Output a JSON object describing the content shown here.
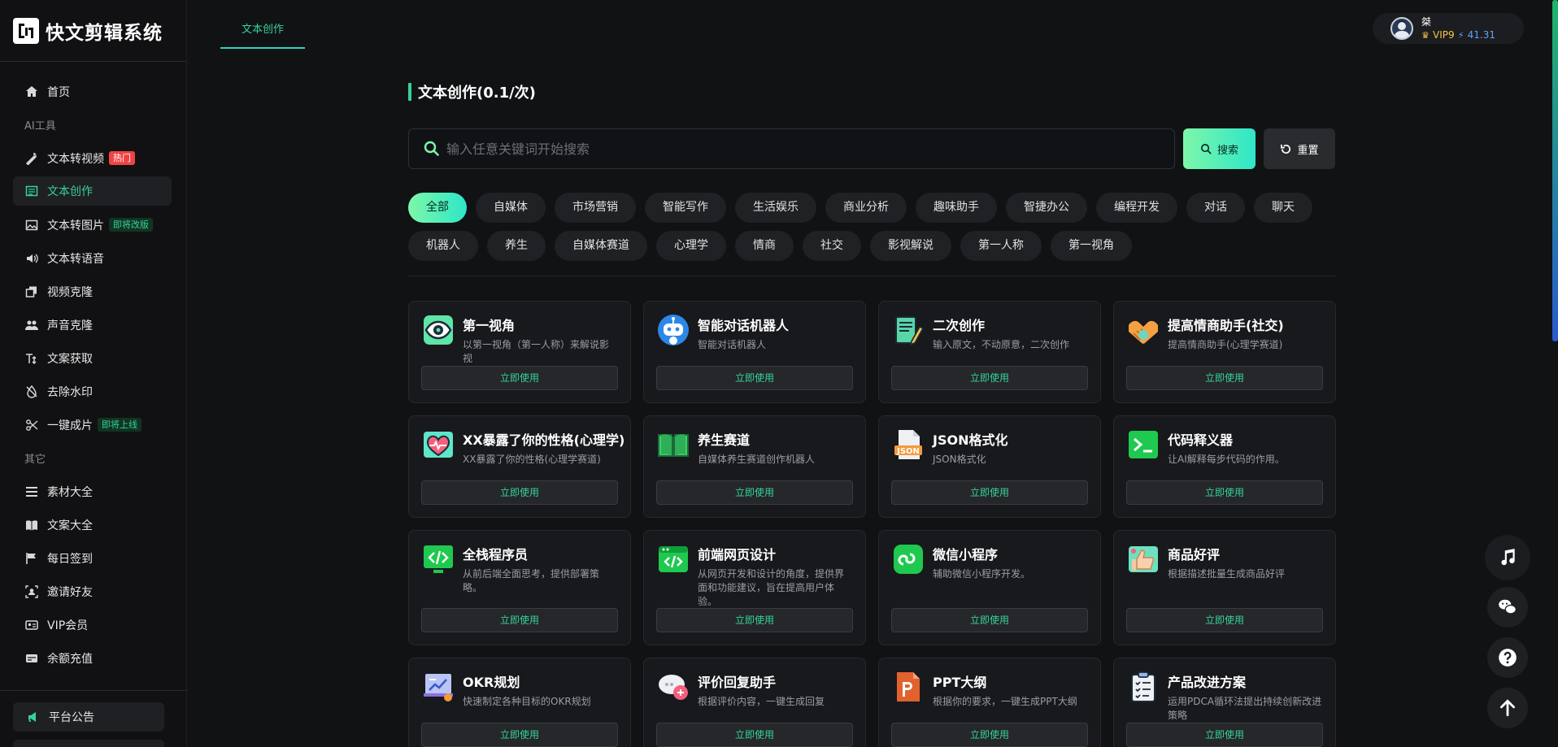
{
  "app": {
    "name": "快文剪辑系统"
  },
  "sidebar": {
    "items": [
      {
        "type": "item",
        "label": "首页",
        "icon": "home-icon"
      },
      {
        "type": "section",
        "label": "AI工具"
      },
      {
        "type": "item",
        "label": "文本转视频",
        "icon": "wand-icon",
        "badge": "热门"
      },
      {
        "type": "item",
        "label": "文本创作",
        "icon": "document-icon",
        "active": true
      },
      {
        "type": "item",
        "label": "文本转图片",
        "icon": "image-icon",
        "badge": "即将改版"
      },
      {
        "type": "item",
        "label": "文本转语音",
        "icon": "speaker-icon"
      },
      {
        "type": "item",
        "label": "视频克隆",
        "icon": "copy-icon"
      },
      {
        "type": "item",
        "label": "声音克隆",
        "icon": "users-icon"
      },
      {
        "type": "item",
        "label": "文案获取",
        "icon": "text-icon"
      },
      {
        "type": "item",
        "label": "去除水印",
        "icon": "no-drop-icon"
      },
      {
        "type": "item",
        "label": "一键成片",
        "icon": "scissors-icon",
        "badge": "即将上线"
      },
      {
        "type": "section",
        "label": "其它"
      },
      {
        "type": "item",
        "label": "素材大全",
        "icon": "list-icon"
      },
      {
        "type": "item",
        "label": "文案大全",
        "icon": "book-icon"
      },
      {
        "type": "item",
        "label": "每日签到",
        "icon": "flag-icon"
      },
      {
        "type": "item",
        "label": "邀请好友",
        "icon": "invite-icon"
      },
      {
        "type": "item",
        "label": "VIP会员",
        "icon": "card-icon"
      },
      {
        "type": "item",
        "label": "余额充值",
        "icon": "wallet-icon"
      }
    ],
    "announcement": "平台公告"
  },
  "topbar": {
    "tab": "文本创作",
    "user": {
      "name": "桀",
      "vip": "VIP9",
      "balance": "41.31"
    }
  },
  "main": {
    "title": "文本创作(0.1/次)",
    "search": {
      "placeholder": "输入任意关键词开始搜索",
      "value": "",
      "search_label": "搜索",
      "reset_label": "重置"
    },
    "categories": [
      "全部",
      "自媒体",
      "市场营销",
      "智能写作",
      "生活娱乐",
      "商业分析",
      "趣味助手",
      "智捷办公",
      "编程开发",
      "对话",
      "聊天",
      "机器人",
      "养生",
      "自媒体赛道",
      "心理学",
      "情商",
      "社交",
      "影视解说",
      "第一人称",
      "第一视角"
    ],
    "active_category": "全部",
    "use_label": "立即使用",
    "cards": [
      {
        "title": "第一视角",
        "desc": "以第一视角（第一人称）来解说影视",
        "icon": "eye-icon"
      },
      {
        "title": "智能对话机器人",
        "desc": "智能对话机器人",
        "icon": "robot-icon"
      },
      {
        "title": "二次创作",
        "desc": "输入原文，不动原意，二次创作",
        "icon": "notebook-icon"
      },
      {
        "title": "提高情商助手(社交)",
        "desc": "提高情商助手(心理学赛道)",
        "icon": "handshake-icon"
      },
      {
        "title": "XX暴露了你的性格(心理学)",
        "desc": "XX暴露了你的性格(心理学赛道)",
        "icon": "heart-monitor-icon"
      },
      {
        "title": "养生赛道",
        "desc": "自媒体养生赛道创作机器人",
        "icon": "open-book-icon"
      },
      {
        "title": "JSON格式化",
        "desc": "JSON格式化",
        "icon": "json-file-icon"
      },
      {
        "title": "代码释义器",
        "desc": "让AI解释每步代码的作用。",
        "icon": "terminal-icon"
      },
      {
        "title": "全栈程序员",
        "desc": "从前后端全面思考，提供部署策略。",
        "icon": "monitor-code-icon"
      },
      {
        "title": "前端网页设计",
        "desc": "从网页开发和设计的角度，提供界面和功能建议，旨在提高用户体验。",
        "icon": "browser-code-icon"
      },
      {
        "title": "微信小程序",
        "desc": "辅助微信小程序开发。",
        "icon": "mini-program-icon"
      },
      {
        "title": "商品好评",
        "desc": "根据描述批量生成商品好评",
        "icon": "thumbs-up-icon"
      },
      {
        "title": "OKR规划",
        "desc": "快速制定各种目标的OKR规划",
        "icon": "chart-board-icon"
      },
      {
        "title": "评价回复助手",
        "desc": "根据评价内容，一键生成回复",
        "icon": "chat-bubble-icon"
      },
      {
        "title": "PPT大纲",
        "desc": "根据你的要求，一键生成PPT大纲",
        "icon": "ppt-icon"
      },
      {
        "title": "产品改进方案",
        "desc": "运用PDCA循环法提出持续创新改进策略",
        "icon": "clipboard-icon"
      }
    ]
  },
  "floating": [
    "music-icon",
    "wechat-icon",
    "help-icon",
    "arrow-up-icon"
  ],
  "colors": {
    "accent": "#34d399",
    "hot": "#ef4444",
    "background": "#111214",
    "card": "#18191c"
  }
}
